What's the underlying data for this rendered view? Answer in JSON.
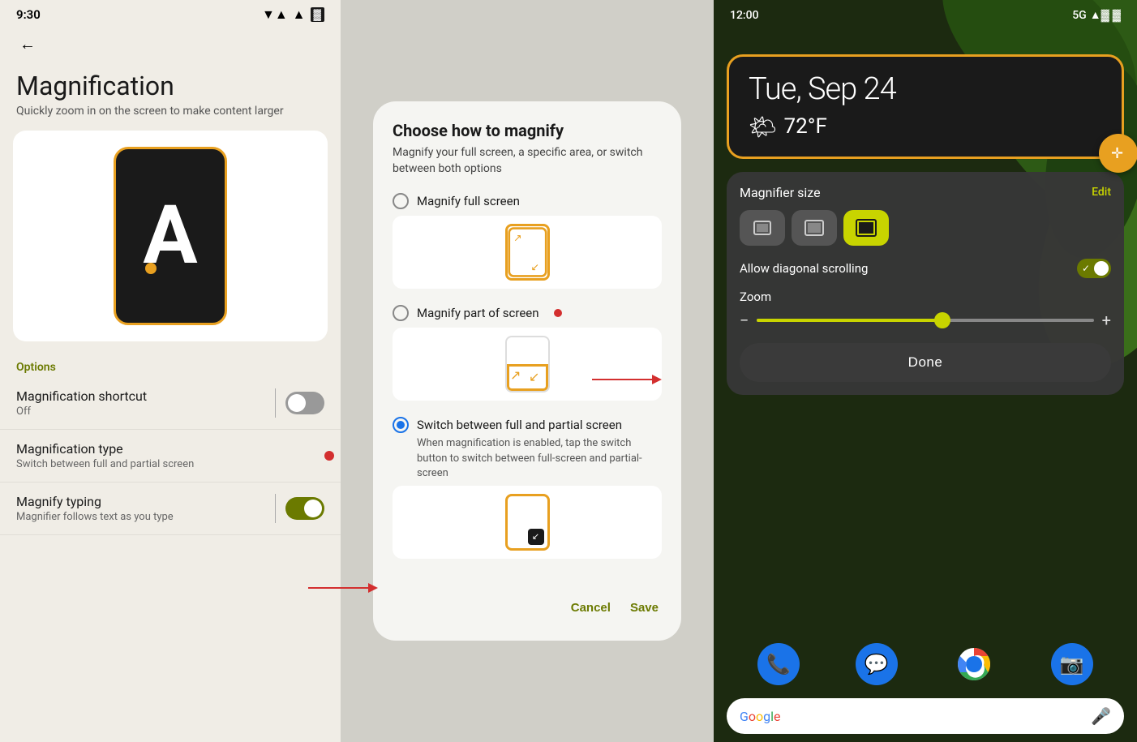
{
  "settings": {
    "statusbar": {
      "time": "9:30",
      "wifi": "▼▲",
      "signal": "▲",
      "battery": "▓"
    },
    "back_btn": "←",
    "title": "Magnification",
    "subtitle": "Quickly zoom in on the screen to make content larger",
    "options_label": "Options",
    "items": [
      {
        "id": "shortcut",
        "title": "Magnification shortcut",
        "subtitle": "Off",
        "toggle_state": "off"
      },
      {
        "id": "type",
        "title": "Magnification type",
        "subtitle": "Switch between full and partial screen",
        "toggle_state": null
      },
      {
        "id": "typing",
        "title": "Magnify typing",
        "subtitle": "Magnifier follows text as you type",
        "toggle_state": "on"
      }
    ]
  },
  "dialog": {
    "title": "Choose how to magnify",
    "description": "Magnify your full screen, a specific area, or switch between both options",
    "options": [
      {
        "id": "full",
        "label": "Magnify full screen",
        "sublabel": "",
        "selected": false
      },
      {
        "id": "part",
        "label": "Magnify part of screen",
        "sublabel": "",
        "selected": false
      },
      {
        "id": "switch",
        "label": "Switch between full and partial screen",
        "sublabel": "When magnification is enabled, tap the switch button to switch between full-screen and partial-screen",
        "selected": true
      }
    ],
    "cancel_btn": "Cancel",
    "save_btn": "Save"
  },
  "phone": {
    "statusbar": {
      "time": "12:00",
      "signal": "5G"
    },
    "clock": {
      "date": "Tue, Sep 24",
      "temp": "72°F",
      "weather_icon": "🌤"
    },
    "magnifier": {
      "title": "Magnifier size",
      "edit_label": "Edit",
      "sizes": [
        "small",
        "medium",
        "large"
      ],
      "active_size": 2,
      "diag_label": "Allow diagonal scrolling",
      "zoom_label": "Zoom",
      "done_label": "Done"
    },
    "dock": {
      "apps": [
        "📞",
        "💬",
        "🌐",
        "📷"
      ]
    },
    "google_bar": {
      "placeholder": ""
    }
  }
}
